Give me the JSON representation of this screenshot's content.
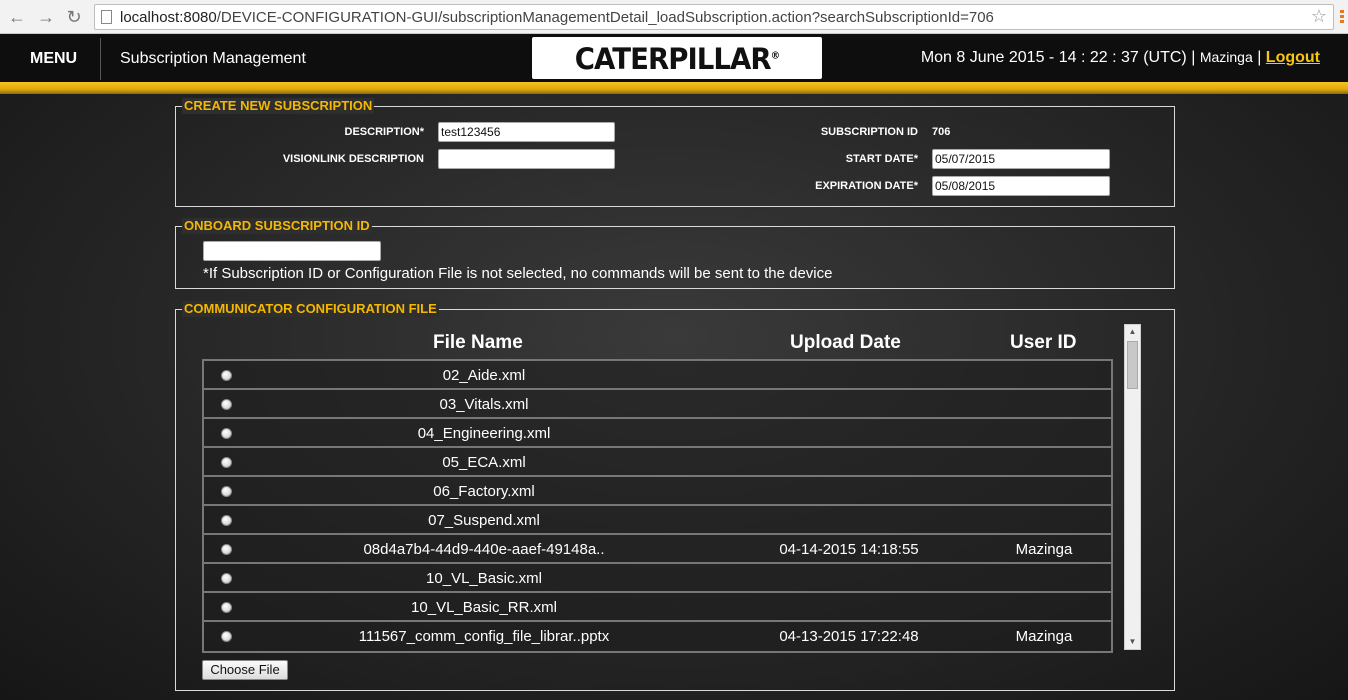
{
  "browser": {
    "url_host": "localhost:8080",
    "url_path": "/DEVICE-CONFIGURATION-GUI/subscriptionManagementDetail_loadSubscription.action?searchSubscriptionId=706"
  },
  "header": {
    "menu_label": "MENU",
    "title": "Subscription Management",
    "logo_text": "CATERPILLAR",
    "logo_mark": "®",
    "datetime": "Mon 8 June 2015 - 14 : 22 : 37 (UTC)",
    "separator": "|",
    "user": "Mazinga",
    "logout_label": "Logout"
  },
  "create_section": {
    "legend": "CREATE NEW SUBSCRIPTION",
    "description_label": "DESCRIPTION*",
    "description_value": "test123456",
    "visionlink_label": "VISIONLINK DESCRIPTION",
    "visionlink_value": "",
    "subscription_id_label": "SUBSCRIPTION ID",
    "subscription_id_value": "706",
    "start_date_label": "START DATE*",
    "start_date_value": "05/07/2015",
    "expiration_date_label": "EXPIRATION DATE*",
    "expiration_date_value": "05/08/2015"
  },
  "onboard_section": {
    "legend": "ONBOARD SUBSCRIPTION ID",
    "input_value": "",
    "note": "*If Subscription ID or Configuration File is not selected, no commands will be sent to the device"
  },
  "config_section": {
    "legend": "COMMUNICATOR CONFIGURATION FILE",
    "columns": {
      "file_name": "File Name",
      "upload_date": "Upload Date",
      "user_id": "User ID"
    },
    "files": [
      {
        "name": "02_Aide.xml",
        "date": "",
        "user": ""
      },
      {
        "name": "03_Vitals.xml",
        "date": "",
        "user": ""
      },
      {
        "name": "04_Engineering.xml",
        "date": "",
        "user": ""
      },
      {
        "name": "05_ECA.xml",
        "date": "",
        "user": ""
      },
      {
        "name": "06_Factory.xml",
        "date": "",
        "user": ""
      },
      {
        "name": "07_Suspend.xml",
        "date": "",
        "user": ""
      },
      {
        "name": "08d4a7b4-44d9-440e-aaef-49148a..",
        "date": "04-14-2015 14:18:55",
        "user": "Mazinga"
      },
      {
        "name": "10_VL_Basic.xml",
        "date": "",
        "user": ""
      },
      {
        "name": "10_VL_Basic_RR.xml",
        "date": "",
        "user": ""
      },
      {
        "name": "111567_comm_config_file_librar..pptx",
        "date": "04-13-2015 17:22:48",
        "user": "Mazinga"
      }
    ],
    "choose_file_label": "Choose File"
  }
}
